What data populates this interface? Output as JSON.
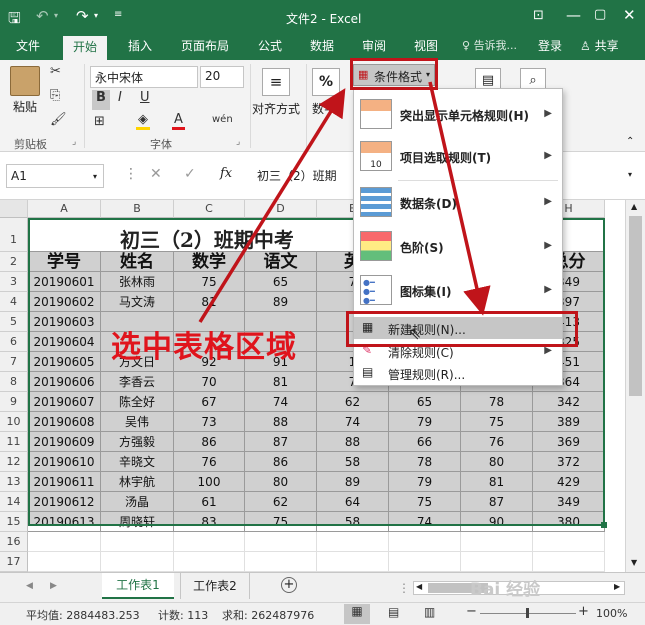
{
  "title_bar": {
    "title": "文件2 - Excel"
  },
  "tabs": [
    {
      "label": "文件"
    },
    {
      "label": "开始"
    },
    {
      "label": "插入"
    },
    {
      "label": "页面布局"
    },
    {
      "label": "公式"
    },
    {
      "label": "数据"
    },
    {
      "label": "审阅"
    },
    {
      "label": "视图"
    },
    {
      "label": "告诉我..."
    },
    {
      "label": "登录"
    },
    {
      "label": "共享"
    }
  ],
  "ribbon": {
    "paste_label": "粘贴",
    "clipboard_group": "剪贴板",
    "font_name": "永中宋体",
    "font_size": "20",
    "bold_glyph": "B",
    "italic_glyph": "I",
    "underline_glyph": "U",
    "font_group": "字体",
    "align_label": "对齐方式",
    "number_label": "数字",
    "number_glyph": "%",
    "cond_format_label": "条件格式"
  },
  "formula_bar": {
    "name_box": "A1",
    "fx_glyph": "fx",
    "content": "初三（2）班期"
  },
  "columns": [
    "A",
    "B",
    "C",
    "D",
    "E",
    "F",
    "G",
    "H"
  ],
  "sheet": {
    "title": "初三（2）班期中考",
    "header": [
      "学号",
      "姓名",
      "数学",
      "语文",
      "英",
      "",
      "",
      "总分"
    ],
    "rows": [
      [
        "20190601",
        "张林雨",
        "75",
        "65",
        "7",
        "",
        "",
        "349"
      ],
      [
        "20190602",
        "马文涛",
        "81",
        "89",
        "",
        "",
        "",
        "397"
      ],
      [
        "20190603",
        "",
        "",
        "",
        "",
        "",
        "",
        "413"
      ],
      [
        "20190604",
        "",
        "",
        "",
        "",
        "",
        "",
        "325"
      ],
      [
        "20190605",
        "方文日",
        "92",
        "91",
        "1",
        "",
        "",
        "451"
      ],
      [
        "20190606",
        "李香云",
        "70",
        "81",
        "7",
        "",
        "",
        "364"
      ],
      [
        "20190607",
        "陈全好",
        "67",
        "74",
        "62",
        "65",
        "78",
        "342"
      ],
      [
        "20190608",
        "吴伟",
        "73",
        "88",
        "74",
        "79",
        "75",
        "389"
      ],
      [
        "20190609",
        "方强毅",
        "86",
        "87",
        "88",
        "66",
        "76",
        "369"
      ],
      [
        "20190610",
        "辛晓文",
        "76",
        "86",
        "58",
        "78",
        "80",
        "372"
      ],
      [
        "20190611",
        "林宇航",
        "100",
        "80",
        "89",
        "79",
        "81",
        "429"
      ],
      [
        "20190612",
        "汤晶",
        "61",
        "62",
        "64",
        "75",
        "87",
        "349"
      ],
      [
        "20190613",
        "周晓轩",
        "83",
        "75",
        "58",
        "74",
        "90",
        "380"
      ]
    ],
    "row_numbers": [
      "1",
      "2",
      "3",
      "4",
      "5",
      "6",
      "7",
      "8",
      "9",
      "10",
      "11",
      "12",
      "13",
      "14",
      "15",
      "16",
      "17",
      "18"
    ]
  },
  "context_menu": {
    "items": [
      {
        "label": "突出显示单元格规则(H)",
        "has_submenu": true
      },
      {
        "label": "项目选取规则(T)",
        "has_submenu": true
      },
      {
        "label": "数据条(D)",
        "has_submenu": true
      },
      {
        "label": "色阶(S)",
        "has_submenu": true
      },
      {
        "label": "图标集(I)",
        "has_submenu": true
      },
      {
        "label": "新建规则(N)...",
        "has_submenu": false
      },
      {
        "label": "清除规则(C)",
        "has_submenu": true
      },
      {
        "label": "管理规则(R)...",
        "has_submenu": false
      }
    ]
  },
  "annotation": {
    "text": "选中表格区域",
    "color": "#e0141c"
  },
  "sheet_tabs": [
    {
      "label": "工作表1"
    },
    {
      "label": "工作表2"
    }
  ],
  "status_bar": {
    "average": "平均值: 2884483.253",
    "count": "计数: 113",
    "sum": "求和: 262487976",
    "zoom": "100%"
  },
  "watermark": {
    "text": "Bai 经验"
  },
  "colors": {
    "excel_green": "#217346",
    "selection_fill": "#d0d0d0",
    "annotation_red": "#e0141c"
  }
}
